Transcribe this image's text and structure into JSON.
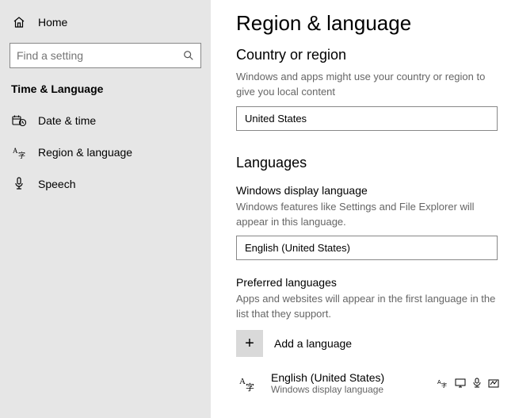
{
  "sidebar": {
    "home": "Home",
    "search_placeholder": "Find a setting",
    "category": "Time & Language",
    "items": [
      {
        "label": "Date & time"
      },
      {
        "label": "Region & language"
      },
      {
        "label": "Speech"
      }
    ]
  },
  "main": {
    "title": "Region & language",
    "section_region": {
      "heading": "Country or region",
      "desc": "Windows and apps might use your country or region to give you local content",
      "value": "United States"
    },
    "section_langs": {
      "heading": "Languages",
      "display_lang_heading": "Windows display language",
      "display_lang_desc": "Windows features like Settings and File Explorer will appear in this language.",
      "display_lang_value": "English (United States)",
      "preferred_heading": "Preferred languages",
      "preferred_desc": "Apps and websites will appear in the first language in the list that they support.",
      "add_label": "Add a language",
      "lang_item": {
        "name": "English (United States)",
        "sub": "Windows display language"
      }
    }
  }
}
